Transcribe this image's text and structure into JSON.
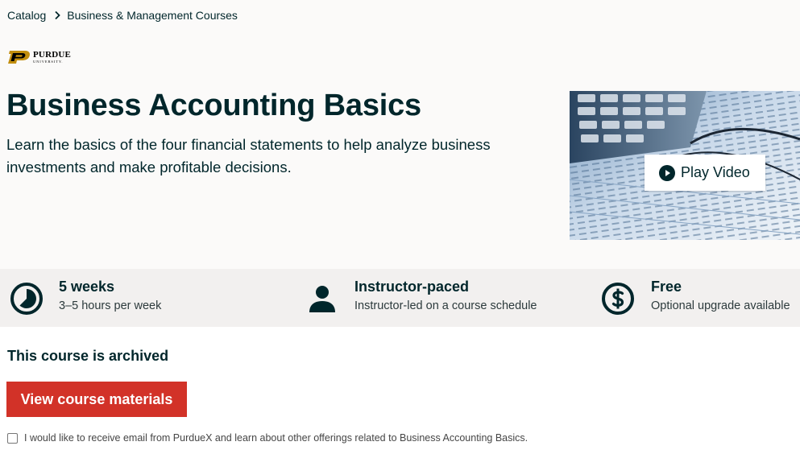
{
  "breadcrumb": {
    "items": [
      "Catalog",
      "Business & Management Courses"
    ],
    "separator_icon": "chevron-right-icon"
  },
  "partner": {
    "name": "PURDUE",
    "subname": "UNIVERSITY."
  },
  "course": {
    "title": "Business Accounting Basics",
    "subtitle": "Learn the basics of the four financial statements to help analyze business investments and make profitable decisions."
  },
  "video": {
    "play_label": "Play Video",
    "icon": "play-icon"
  },
  "stats": [
    {
      "icon": "clock-icon",
      "heading": "5 weeks",
      "detail": "3–5 hours per week"
    },
    {
      "icon": "person-icon",
      "heading": "Instructor-paced",
      "detail": "Instructor-led on a course schedule"
    },
    {
      "icon": "dollar-icon",
      "heading": "Free",
      "detail": "Optional upgrade available"
    }
  ],
  "enroll": {
    "status": "This course is archived",
    "button_label": "View course materials",
    "optin_label": "I would like to receive email from PurdueX and learn about other offerings related to Business Accounting Basics.",
    "optin_checked": false
  },
  "colors": {
    "primary_text": "#00262b",
    "brand_red": "#d23228",
    "hero_bg": "#fbfaf9",
    "stats_bg": "#f2f0ef"
  }
}
